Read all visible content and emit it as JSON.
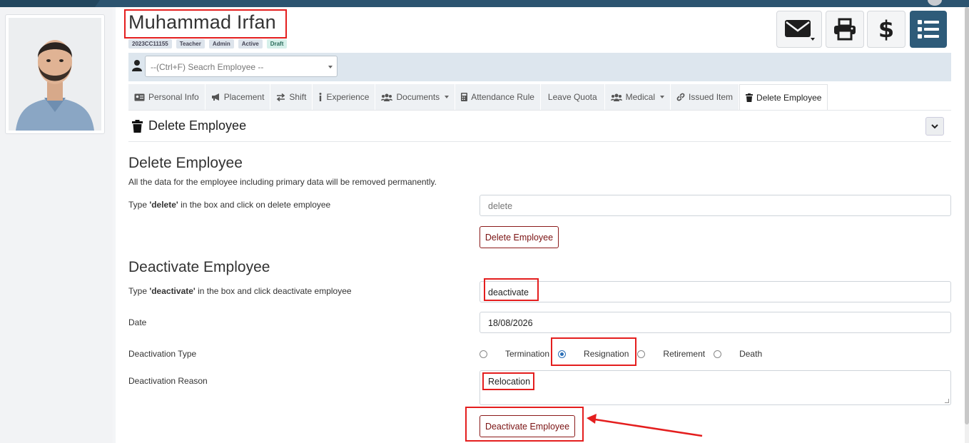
{
  "employee": {
    "name": "Muhammad Irfan",
    "badges": [
      "2023CC11155",
      "Teacher",
      "Admin",
      "Active",
      "Draft"
    ]
  },
  "header_icons": [
    "envelope-icon",
    "printer-icon",
    "dollar-icon",
    "list-icon"
  ],
  "search": {
    "placeholder": "--(Ctrl+F) Seacrh Employee --"
  },
  "tabs": [
    {
      "label": "Personal Info",
      "icon": "id-card-icon"
    },
    {
      "label": "Placement",
      "icon": "bullhorn-icon"
    },
    {
      "label": "Shift",
      "icon": "exchange-icon"
    },
    {
      "label": "Experience",
      "icon": "info-icon"
    },
    {
      "label": "Documents",
      "icon": "users-icon"
    },
    {
      "label": "Attendance Rule",
      "icon": "calculator-icon"
    },
    {
      "label": "Leave Quota",
      "icon": ""
    },
    {
      "label": "Medical",
      "icon": "users-icon"
    },
    {
      "label": "Issued Item",
      "icon": "link-icon"
    },
    {
      "label": "Delete Employee",
      "icon": "trash-icon"
    }
  ],
  "panel": {
    "title": "Delete Employee"
  },
  "delete_section": {
    "heading": "Delete Employee",
    "description": "All the data for the employee including primary data will be removed permanently.",
    "instruction_prefix": "Type ",
    "instruction_keyword": "'delete'",
    "instruction_suffix": " in the box and click on delete employee",
    "input_placeholder": "delete",
    "button_label": "Delete Employee"
  },
  "deactivate_section": {
    "heading": "Deactivate Employee",
    "instruction_prefix": "Type ",
    "instruction_keyword": "'deactivate'",
    "instruction_suffix": " in the box and click deactivate employee",
    "input_value": "deactivate",
    "date_label": "Date",
    "date_value": "18/08/2026",
    "type_label": "Deactivation Type",
    "types": [
      "Termination",
      "Resignation",
      "Retirement",
      "Death"
    ],
    "selected_type": "Resignation",
    "reason_label": "Deactivation Reason",
    "reason_value": "Relocation",
    "button_label": "Deactivate Employee"
  },
  "colors": {
    "topbar": "#2c5470",
    "primary_button": "#2e5b79",
    "danger_outline": "#8b1a1a",
    "highlight": "#e41e1e"
  }
}
